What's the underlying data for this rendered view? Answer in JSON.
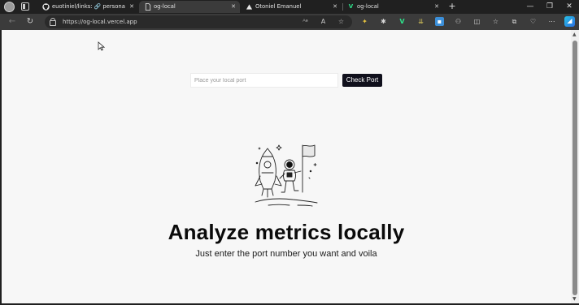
{
  "browser": {
    "tabs": [
      {
        "title": "euotiniel/links: 🔗 personal links",
        "favicon": "github-icon",
        "active": false
      },
      {
        "title": "og-local",
        "favicon": "page-icon",
        "active": true
      },
      {
        "title": "Otoniel Emanuel",
        "favicon": "vercel-icon",
        "active": false
      },
      {
        "title": "og-local",
        "favicon": "vercel-v-icon",
        "active": false
      }
    ],
    "url": "https://og-local.vercel.app"
  },
  "page": {
    "port_input": {
      "placeholder": "Place your local port",
      "value": ""
    },
    "check_button": "Check Port",
    "headline": "Analyze metrics locally",
    "subline": "Just enter the port number you want and voila"
  },
  "colors": {
    "button_bg": "#10101c",
    "page_bg": "#f7f7f7",
    "chrome_bg": "#202020",
    "toolbar_bg": "#3b3b3b"
  }
}
